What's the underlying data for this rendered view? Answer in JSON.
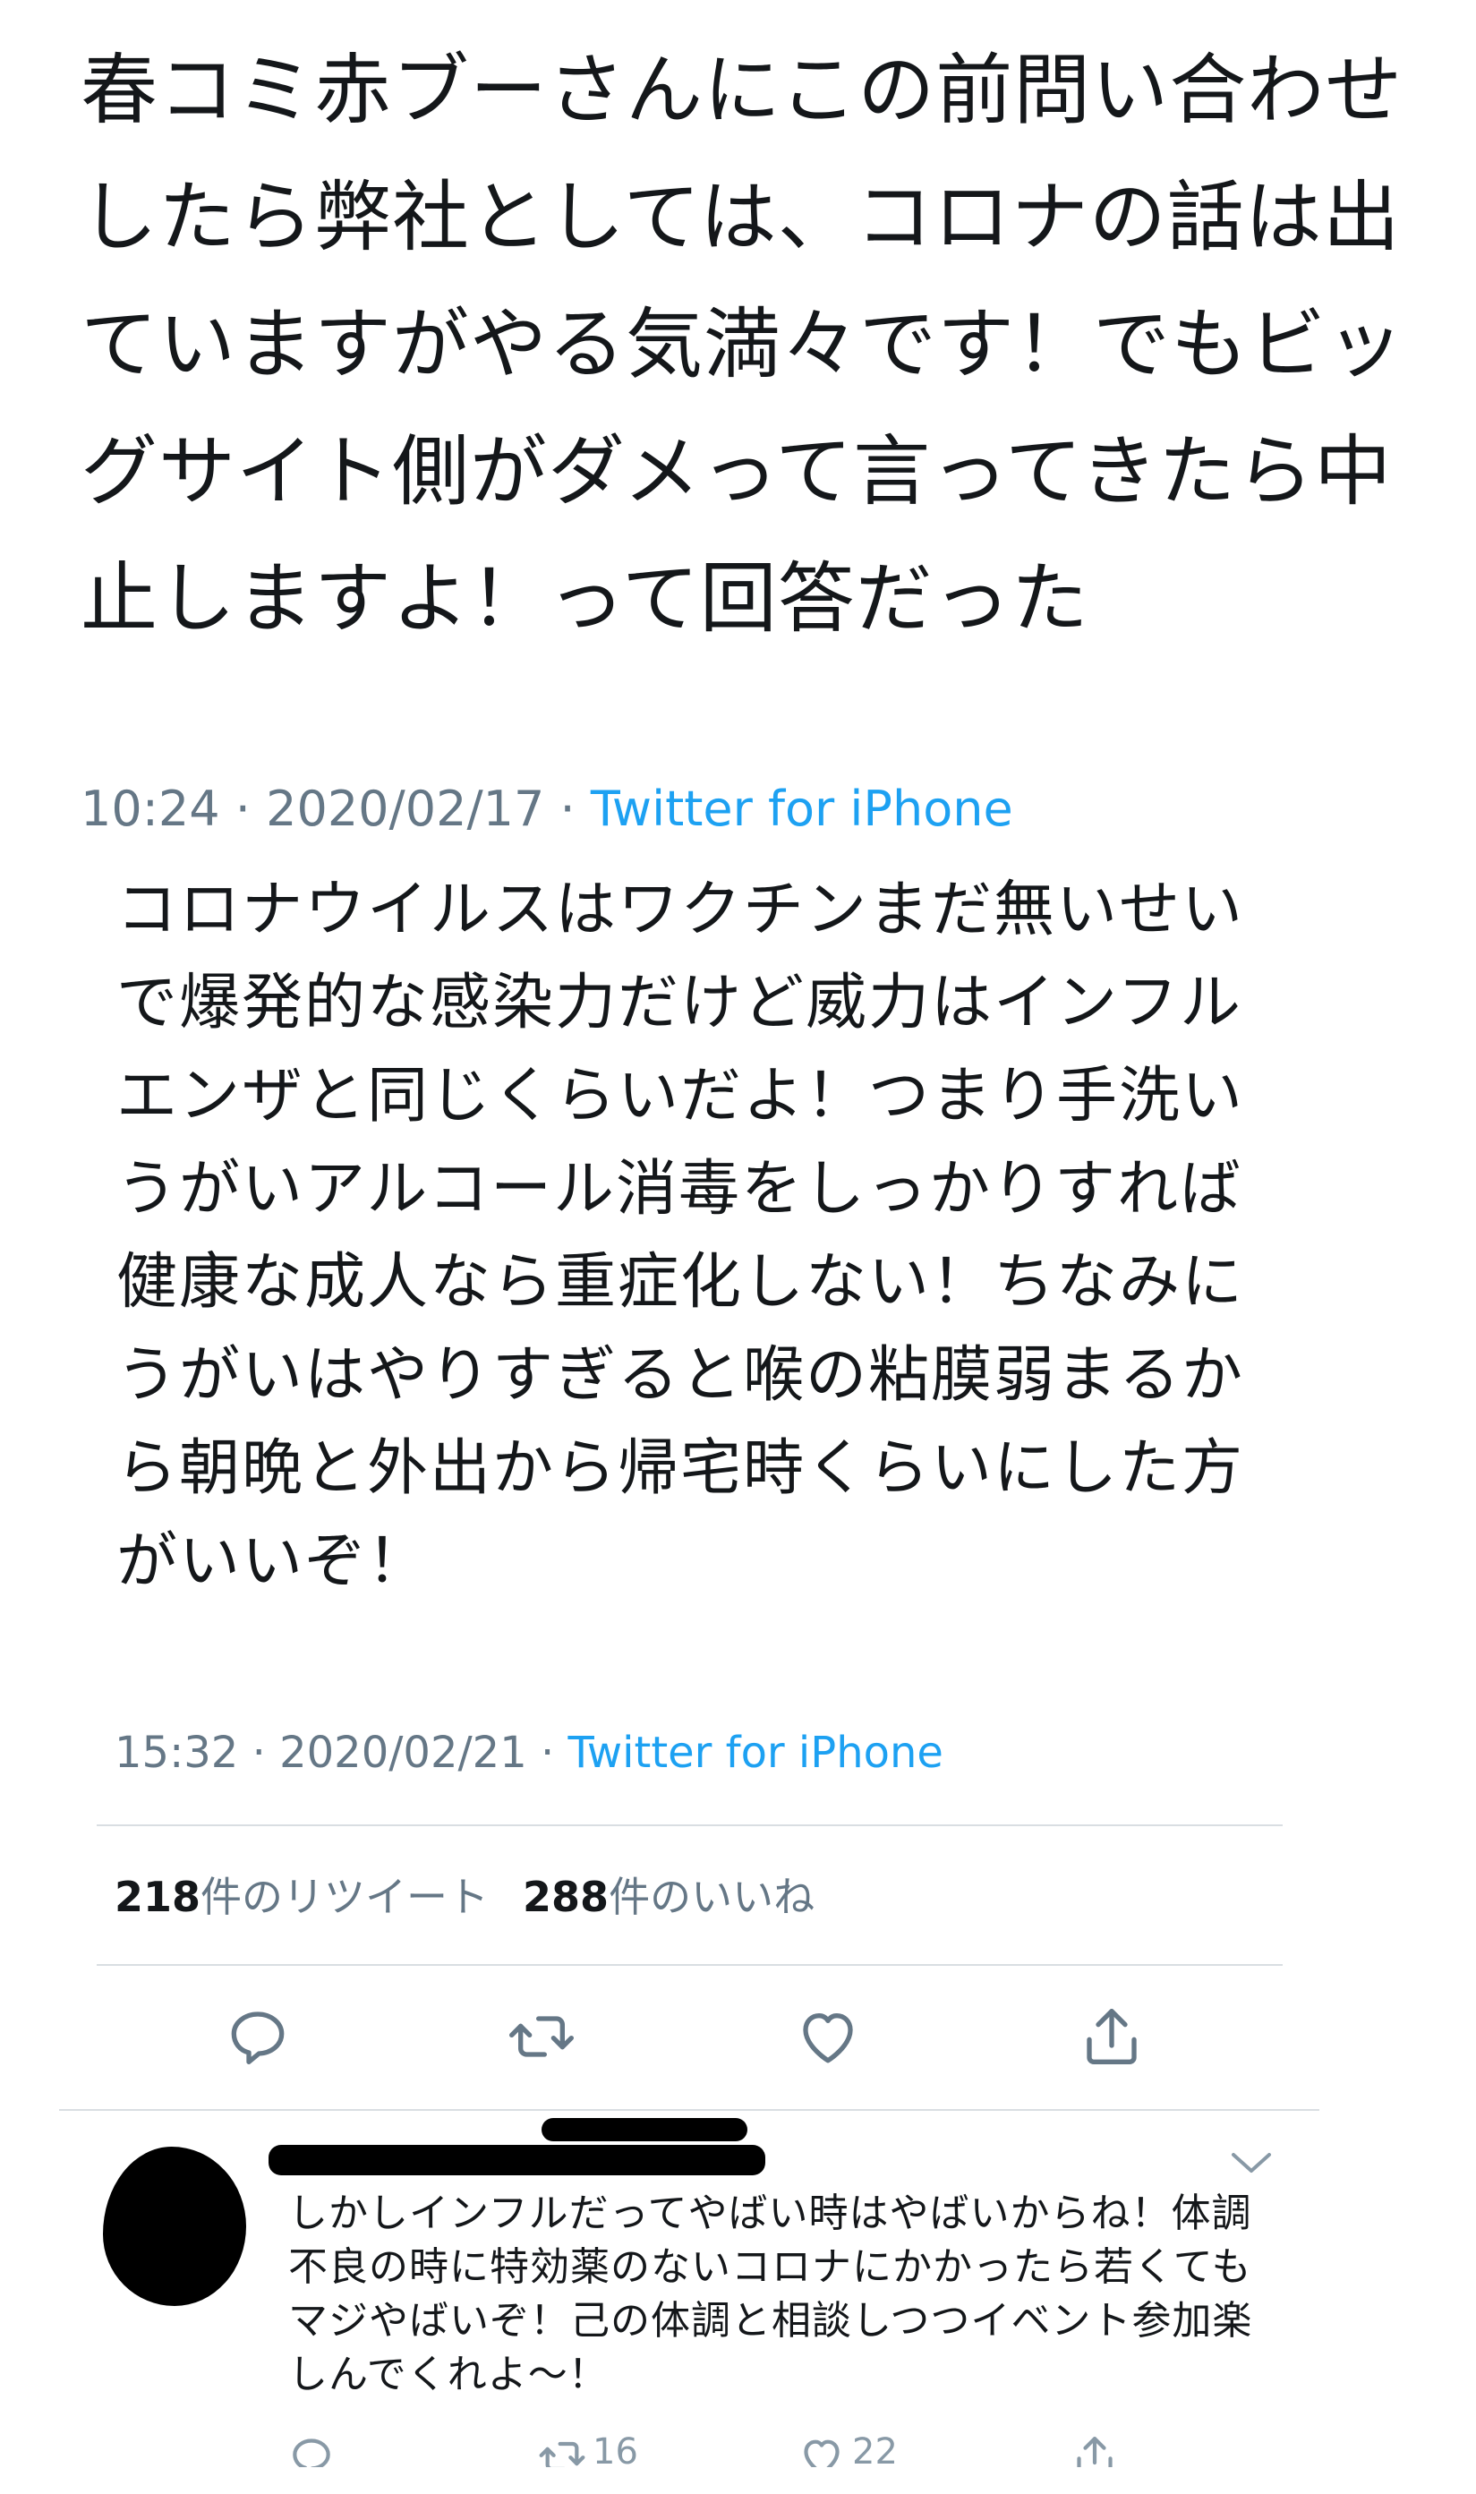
{
  "tweet1": {
    "text": "春コミ赤ブーさんにこの前問い合わせしたら弊社としては、コロナの話は出ていますがやる気満々です！でもビッグサイト側がダメって言ってきたら中止しますよ！って回答だった",
    "time": "10:24 · 2020/02/17 · ",
    "source": "Twitter for iPhone"
  },
  "tweet2": {
    "text": "コロナウイルスはワクチンまだ無いせいで爆発的な感染力だけど威力はインフルエンザと同じくらいだよ！つまり手洗いうがいアルコール消毒をしっかりすれば健康な成人なら重症化しない！ちなみにうがいはやりすぎると喉の粘膜弱まるから朝晩と外出から帰宅時くらいにした方がいいぞ！",
    "time": "15:32 · 2020/02/21 · ",
    "source": "Twitter for iPhone",
    "retweet_count": "218",
    "retweet_label": "件のリツイート",
    "like_count": "288",
    "like_label": "件のいいね"
  },
  "reply": {
    "text": "しかしインフルだってやばい時はやばいからね！体調不良の時に特効薬のないコロナにかかったら若くてもマジやばいぞ！己の体調と相談しつつイベント参加楽しんでくれよ〜！",
    "retweet_count": "16",
    "like_count": "22"
  },
  "icons": {
    "reply": "reply-icon",
    "retweet": "retweet-icon",
    "like": "heart-icon",
    "share": "share-icon",
    "menu": "chevron-down-icon"
  },
  "colors": {
    "text": "#14171a",
    "meta": "#657786",
    "link": "#1da1f2",
    "icon": "#657786",
    "divider": "#d9dee2"
  }
}
